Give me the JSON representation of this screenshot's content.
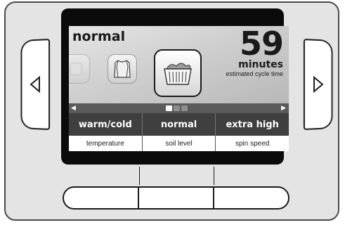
{
  "display": {
    "cycle_name": "normal",
    "time_value": "59",
    "time_unit": "minutes",
    "time_caption": "estimated cycle time"
  },
  "carousel": {
    "icons": [
      "cycle-faded-icon",
      "shirt-icon",
      "laundry-basket-icon"
    ],
    "page_count": 3,
    "active_page": 1
  },
  "options": [
    {
      "value": "warm/cold",
      "label": "temperature"
    },
    {
      "value": "normal",
      "label": "soil level"
    },
    {
      "value": "extra high",
      "label": "spin speed"
    }
  ],
  "icons": {
    "left": "left-arrow-icon",
    "right": "right-arrow-icon"
  },
  "colors": {
    "option_bar": "#3f3f3f",
    "nav_strip": "#5a5a5a",
    "bezel": "#0b0b0b"
  }
}
